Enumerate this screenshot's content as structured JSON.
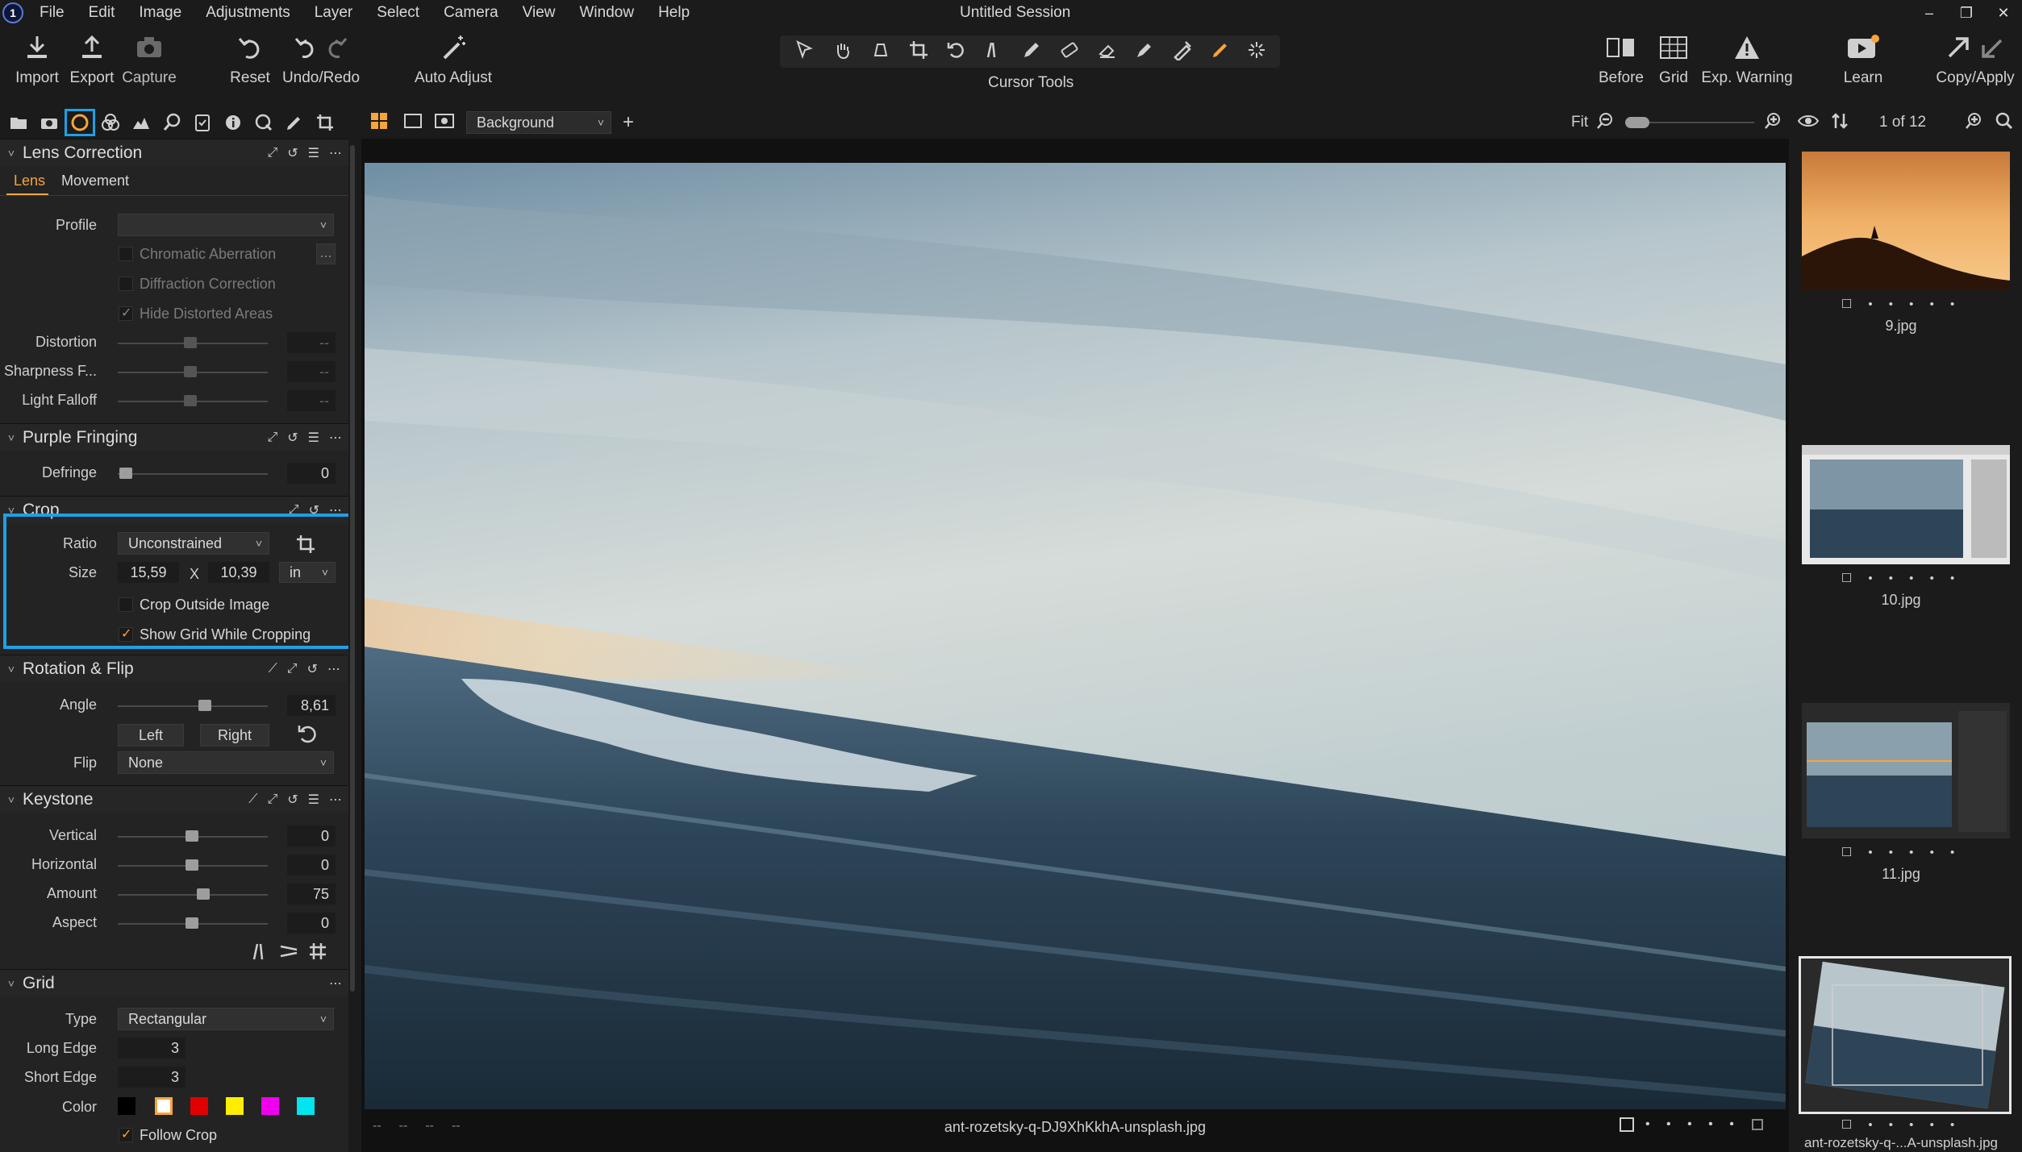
{
  "app": {
    "logo": "1",
    "window_title": "Untitled Session",
    "menu": [
      "File",
      "Edit",
      "Image",
      "Adjustments",
      "Layer",
      "Select",
      "Camera",
      "View",
      "Window",
      "Help"
    ]
  },
  "toolbar": {
    "left": [
      {
        "label": "Import",
        "icon": "import-icon"
      },
      {
        "label": "Export",
        "icon": "export-icon"
      },
      {
        "label": "Capture",
        "icon": "camera-icon"
      },
      {
        "label": "Reset",
        "icon": "reset-icon"
      },
      {
        "label": "Undo/Redo",
        "icon": "undo-icon"
      },
      {
        "label": "Auto Adjust",
        "icon": "magic-wand-icon"
      }
    ],
    "cursor_tools_label": "Cursor Tools",
    "right": [
      {
        "label": "Before",
        "icon": "before-icon"
      },
      {
        "label": "Grid",
        "icon": "grid-icon"
      },
      {
        "label": "Exp. Warning",
        "icon": "warning-icon"
      },
      {
        "label": "Learn",
        "icon": "learn-icon"
      },
      {
        "label": "Copy/Apply",
        "icon": "copy-apply-icon"
      }
    ]
  },
  "viewer_bar": {
    "layer": "Background",
    "zoom_label": "Fit"
  },
  "browser_bar": {
    "counter": "1 of 12"
  },
  "lens_correction": {
    "title": "Lens Correction",
    "tabs": [
      "Lens",
      "Movement"
    ],
    "profile_label": "Profile",
    "chromatic_aberration": "Chromatic Aberration",
    "diffraction_correction": "Diffraction Correction",
    "hide_distorted_areas": "Hide Distorted Areas",
    "distortion_label": "Distortion",
    "sharpness_label": "Sharpness F...",
    "light_falloff_label": "Light Falloff",
    "empty_value": "--",
    "more_button": "..."
  },
  "purple_fringing": {
    "title": "Purple Fringing",
    "defringe_label": "Defringe",
    "defringe_value": "0"
  },
  "crop": {
    "title": "Crop",
    "ratio_label": "Ratio",
    "ratio_value": "Unconstrained",
    "size_label": "Size",
    "width": "15,59",
    "x_sep": "X",
    "height": "10,39",
    "unit": "in",
    "crop_outside": "Crop Outside Image",
    "show_grid": "Show Grid While Cropping"
  },
  "rotation": {
    "title": "Rotation & Flip",
    "angle_label": "Angle",
    "angle_value": "8,61",
    "left_button": "Left",
    "right_button": "Right",
    "flip_label": "Flip",
    "flip_value": "None"
  },
  "keystone": {
    "title": "Keystone",
    "vertical_label": "Vertical",
    "vertical_value": "0",
    "horizontal_label": "Horizontal",
    "horizontal_value": "0",
    "amount_label": "Amount",
    "amount_value": "75",
    "aspect_label": "Aspect",
    "aspect_value": "0"
  },
  "grid": {
    "title": "Grid",
    "type_label": "Type",
    "type_value": "Rectangular",
    "long_edge_label": "Long Edge",
    "long_edge_value": "3",
    "short_edge_label": "Short Edge",
    "short_edge_value": "3",
    "color_label": "Color",
    "colors": [
      "#000000",
      "#ffffff",
      "#e00000",
      "#ffee00",
      "#ee00ee",
      "#00e5ee"
    ],
    "follow_crop": "Follow Crop"
  },
  "viewer_footer": {
    "left_placeholders": [
      "--",
      "--",
      "--",
      "--"
    ],
    "filename": "ant-rozetsky-q-DJ9XhKkhA-unsplash.jpg"
  },
  "thumbnails": [
    {
      "name": "9.jpg"
    },
    {
      "name": "10.jpg"
    },
    {
      "name": "11.jpg"
    },
    {
      "name": "ant-rozetsky-q-...A-unsplash.jpg"
    }
  ],
  "rating_dots": "• • • • •"
}
